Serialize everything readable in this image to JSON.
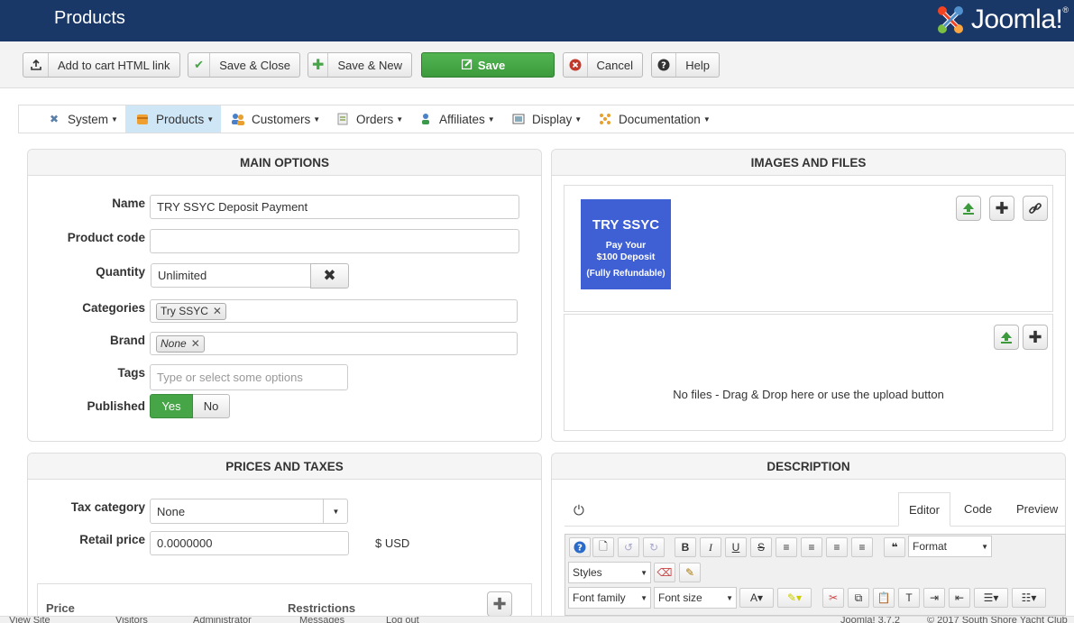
{
  "header": {
    "title": "Products",
    "logo_text": "Joomla!",
    "logo_reg": "®"
  },
  "toolbar": {
    "add_cart_label": "Add to cart HTML link",
    "save_close_label": "Save & Close",
    "save_new_label": "Save & New",
    "save_label": "Save",
    "cancel_label": "Cancel",
    "help_label": "Help"
  },
  "menu": {
    "items": [
      {
        "label": "System",
        "icon": "wrench-icon"
      },
      {
        "label": "Products",
        "icon": "box-icon",
        "active": true
      },
      {
        "label": "Customers",
        "icon": "users-icon"
      },
      {
        "label": "Orders",
        "icon": "orders-icon"
      },
      {
        "label": "Affiliates",
        "icon": "affiliates-icon"
      },
      {
        "label": "Display",
        "icon": "display-icon"
      },
      {
        "label": "Documentation",
        "icon": "documentation-icon"
      }
    ]
  },
  "main_options": {
    "title": "MAIN OPTIONS",
    "name_label": "Name",
    "name_value": "TRY SSYC Deposit Payment",
    "code_label": "Product code",
    "code_value": "",
    "quantity_label": "Quantity",
    "quantity_value": "Unlimited",
    "categories_label": "Categories",
    "category_tag": "Try SSYC",
    "brand_label": "Brand",
    "brand_tag": "None",
    "tags_label": "Tags",
    "tags_placeholder": "Type or select some options",
    "published_label": "Published",
    "yes": "Yes",
    "no": "No"
  },
  "images_files": {
    "title": "IMAGES AND FILES",
    "thumb_line1": "TRY SSYC",
    "thumb_line2": "Pay Your",
    "thumb_line3": "$100 Deposit",
    "thumb_line4": "(Fully Refundable)",
    "no_files": "No files - Drag & Drop here or use the upload button"
  },
  "prices": {
    "title": "PRICES AND TAXES",
    "tax_label": "Tax category",
    "tax_value": "None",
    "retail_label": "Retail price",
    "retail_value": "0.0000000",
    "currency": "$ USD",
    "col_price": "Price",
    "col_restrictions": "Restrictions"
  },
  "description": {
    "title": "DESCRIPTION",
    "tab_editor": "Editor",
    "tab_code": "Code",
    "tab_preview": "Preview",
    "format_label": "Format",
    "styles_label": "Styles",
    "font_family_label": "Font family",
    "font_size_label": "Font size"
  },
  "status": {
    "view_site": "View Site",
    "visitors": "Visitors",
    "administrator": "Administrator",
    "messages": "Messages",
    "logout": "Log out",
    "version": "Joomla! 3.7.2",
    "copyright": "© 2017 South Shore Yacht Club"
  }
}
